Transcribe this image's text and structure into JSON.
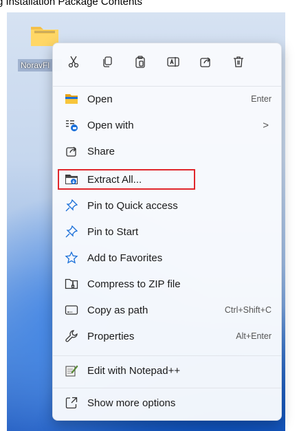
{
  "caption": "g Installation Package Contents",
  "desktop": {
    "folder_label": "NoravFl"
  },
  "toolbar": {
    "cut": "scissors-icon",
    "copy": "copy-icon",
    "paste": "paste-icon",
    "rename": "rename-icon",
    "share": "share-icon",
    "delete": "trash-icon"
  },
  "menu": {
    "items": [
      {
        "label": "Open",
        "shortcut": "Enter",
        "icon": "folder-open-icon"
      },
      {
        "label": "Open with",
        "shortcut": ">",
        "icon": "open-with-icon"
      },
      {
        "label": "Share",
        "shortcut": "",
        "icon": "share-icon"
      },
      {
        "label": "Extract All...",
        "shortcut": "",
        "icon": "extract-icon"
      },
      {
        "label": "Pin to Quick access",
        "shortcut": "",
        "icon": "pin-icon"
      },
      {
        "label": "Pin to Start",
        "shortcut": "",
        "icon": "pin-icon"
      },
      {
        "label": "Add to Favorites",
        "shortcut": "",
        "icon": "star-icon"
      },
      {
        "label": "Compress to ZIP file",
        "shortcut": "",
        "icon": "zip-icon"
      },
      {
        "label": "Copy as path",
        "shortcut": "Ctrl+Shift+C",
        "icon": "copy-path-icon"
      },
      {
        "label": "Properties",
        "shortcut": "Alt+Enter",
        "icon": "wrench-icon"
      },
      {
        "label": "Edit with Notepad++",
        "shortcut": "",
        "icon": "notepad-icon"
      },
      {
        "label": "Show more options",
        "shortcut": "",
        "icon": "more-options-icon"
      }
    ]
  },
  "colors": {
    "highlight": "#e0262b",
    "accent": "#1a6fd8"
  }
}
